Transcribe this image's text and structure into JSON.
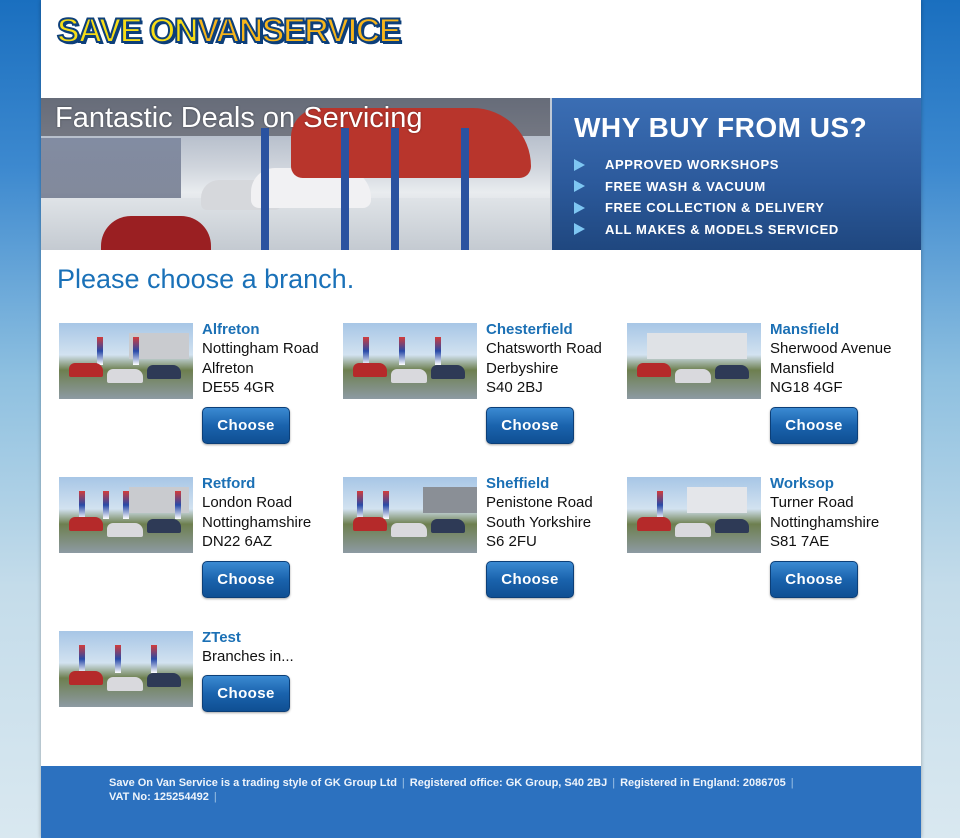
{
  "header": {
    "logo_part1": "SAVE ON",
    "logo_part2": "VAN",
    "logo_part3": "SERVICE"
  },
  "banner": {
    "title": "Fantastic Deals on Servicing",
    "why_title": "WHY BUY FROM US?",
    "benefits": [
      "APPROVED WORKSHOPS",
      "FREE WASH & VACUUM",
      "FREE COLLECTION & DELIVERY",
      "ALL MAKES & MODELS SERVICED"
    ]
  },
  "main": {
    "heading": "Please choose a branch.",
    "choose_label": "Choose",
    "branches": [
      {
        "name": "Alfreton",
        "lines": [
          "Nottingham Road",
          "Alfreton",
          "DE55 4GR"
        ]
      },
      {
        "name": "Chesterfield",
        "lines": [
          "Chatsworth Road",
          "Derbyshire",
          "S40 2BJ"
        ]
      },
      {
        "name": "Mansfield",
        "lines": [
          "Sherwood Avenue",
          "Mansfield",
          "NG18 4GF"
        ]
      },
      {
        "name": "Retford",
        "lines": [
          "London Road",
          "Nottinghamshire",
          "DN22 6AZ"
        ]
      },
      {
        "name": "Sheffield",
        "lines": [
          "Penistone Road",
          "South Yorkshire",
          "S6 2FU"
        ]
      },
      {
        "name": "Worksop",
        "lines": [
          "Turner Road",
          "Nottinghamshire",
          "S81 7AE"
        ]
      },
      {
        "name": "ZTest",
        "lines": [
          "Branches in..."
        ]
      }
    ]
  },
  "footer": {
    "items": [
      "Save On Van Service is a trading style of GK Group Ltd",
      "Registered office: GK Group, S40 2BJ",
      "Registered in England: 2086705",
      "VAT No: 125254492"
    ],
    "separator": "|"
  },
  "colors": {
    "brand_blue": "#1b70b5",
    "button_blue": "#1a63ad",
    "logo_yellow": "#f7dc16",
    "footer_blue": "#2c71bf"
  }
}
